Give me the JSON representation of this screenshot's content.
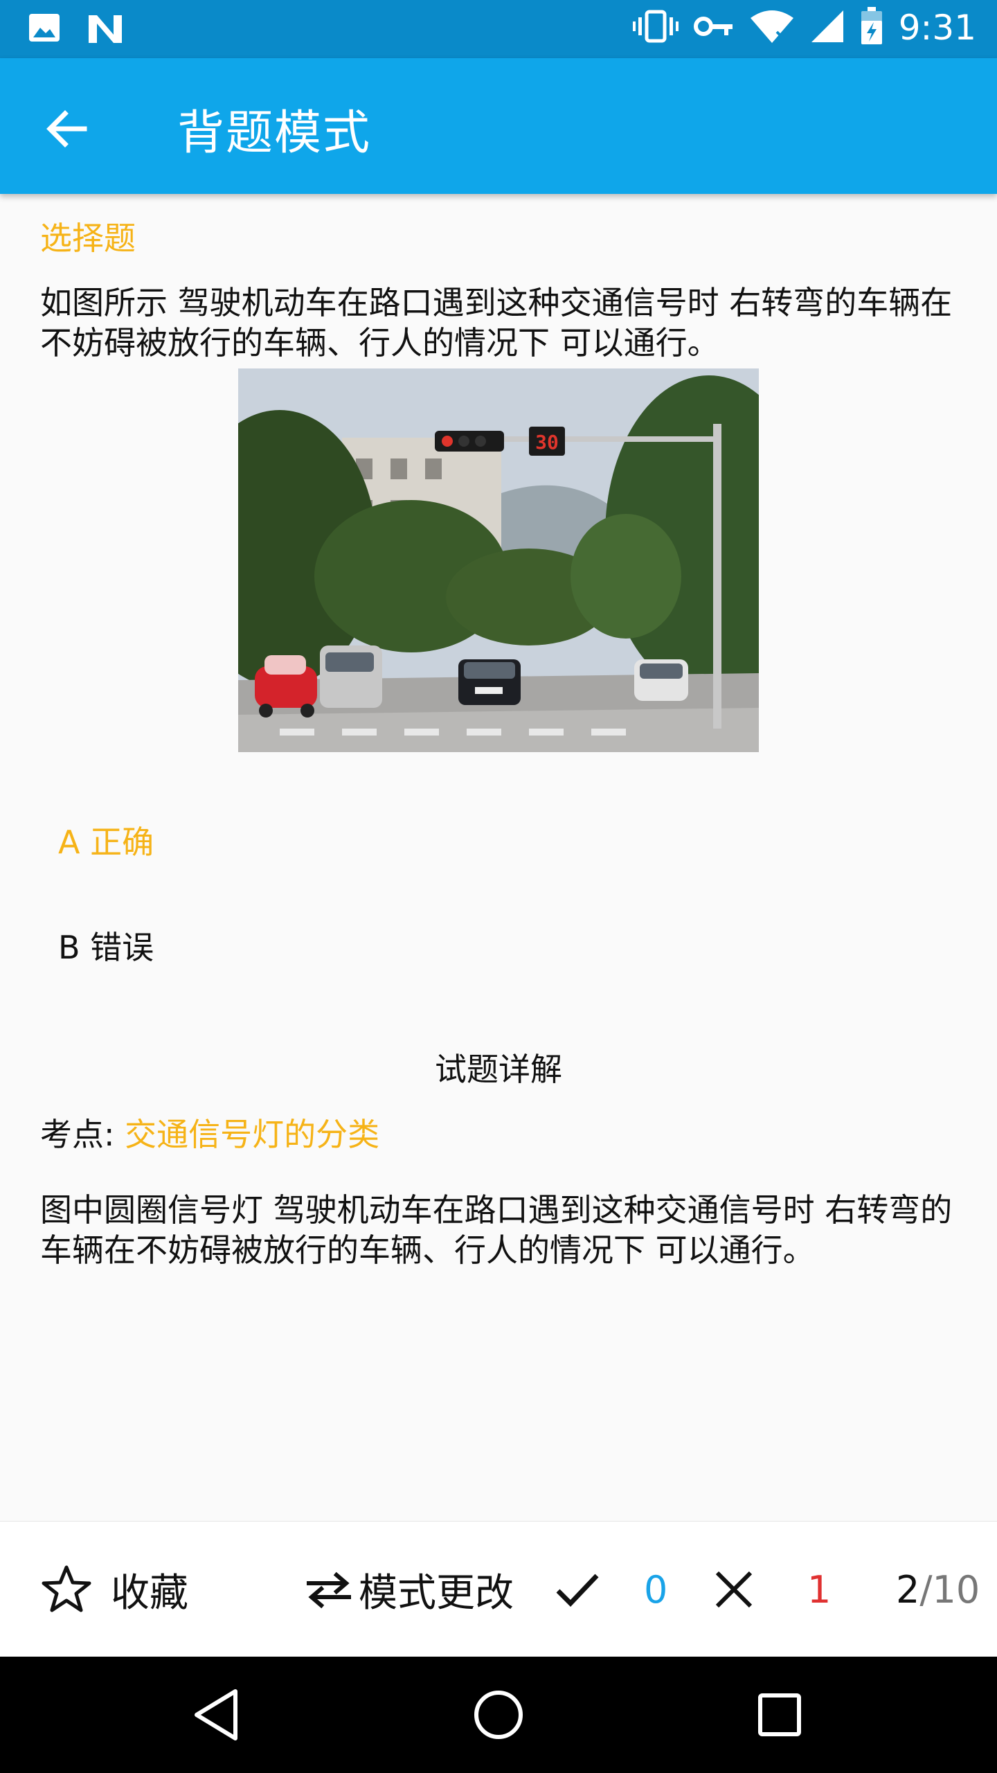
{
  "status_bar": {
    "time": "9:31",
    "left_icons": [
      "image-icon",
      "n-icon"
    ],
    "right_icons": [
      "vibrate-icon",
      "key-icon",
      "wifi-icon",
      "signal-icon",
      "battery-icon"
    ]
  },
  "app_bar": {
    "title": "背题模式",
    "back_icon": "arrow-left-icon"
  },
  "question": {
    "type_label": "选择题",
    "text": "如图所示 驾驶机动车在路口遇到这种交通信号时 右转弯的车辆在不妨碍被放行的车辆、行人的情况下 可以通行。",
    "image_timer_text": "30",
    "options": [
      {
        "label": "A 正确",
        "selected": true
      },
      {
        "label": "B 错误",
        "selected": false
      }
    ]
  },
  "explanation": {
    "title": "试题详解",
    "key_point_label": "考点:",
    "key_point_value": "交通信号灯的分类",
    "text": "图中圆圈信号灯 驾驶机动车在路口遇到这种交通信号时 右转弯的车辆在不妨碍被放行的车辆、行人的情况下 可以通行。"
  },
  "bottom_bar": {
    "favorite_label": "收藏",
    "mode_change_label": "模式更改",
    "correct_count": "0",
    "wrong_count": "1",
    "current": "2",
    "total": "/10"
  },
  "colors": {
    "status_bar": "#0a8ac9",
    "app_bar": "#0fa6ea",
    "accent_yellow": "#f6b317",
    "correct_blue": "#19a3e8",
    "wrong_red": "#e03131"
  }
}
